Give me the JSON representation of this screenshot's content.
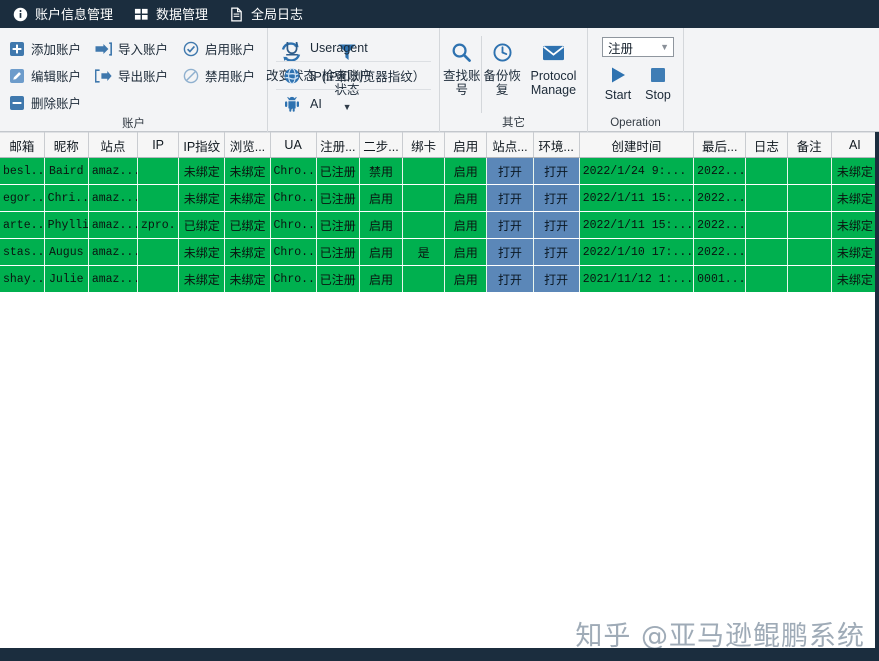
{
  "menubar": {
    "items": [
      {
        "label": "账户信息管理",
        "icon": "info-circle-icon"
      },
      {
        "label": "数据管理",
        "icon": "grid-squares-icon"
      },
      {
        "label": "全局日志",
        "icon": "document-icon"
      }
    ]
  },
  "ribbon": {
    "groups": [
      {
        "name": "account",
        "title": "账户",
        "col1": [
          {
            "label": "添加账户",
            "icon": "plus-square-icon"
          },
          {
            "label": "编辑账户",
            "icon": "pencil-square-icon"
          },
          {
            "label": "删除账户",
            "icon": "minus-square-icon"
          }
        ],
        "col2": [
          {
            "label": "导入账户",
            "icon": "import-arrow-icon"
          },
          {
            "label": "导出账户",
            "icon": "export-arrow-icon"
          }
        ],
        "col3": [
          {
            "label": "启用账户",
            "icon": "check-circle-icon"
          },
          {
            "label": "禁用账户",
            "icon": "ban-circle-icon"
          }
        ],
        "big": [
          {
            "label": "改变状态",
            "icon": "refresh-icon",
            "caret": "▼"
          },
          {
            "label": "检查账户状态",
            "icon": "filter-icon",
            "caret": "▼"
          }
        ]
      },
      {
        "name": "fingerprint",
        "title": "",
        "rows": [
          {
            "label": "Useragent",
            "icon": "underline-u-icon"
          },
          {
            "label": "IP(IP和浏览器指纹）",
            "icon": "globe-icon"
          },
          {
            "label": "AI",
            "icon": "android-robot-icon"
          }
        ]
      },
      {
        "name": "other",
        "title": "其它",
        "big": [
          {
            "label": "查找账号",
            "icon": "magnifier-icon"
          },
          {
            "label": "备份恢复",
            "icon": "clock-icon"
          },
          {
            "label": "Protocol Manage",
            "icon": "envelope-icon"
          }
        ]
      },
      {
        "name": "operation",
        "title": "Operation",
        "combo_value": "注册",
        "combo_caret": "▼",
        "buttons": [
          {
            "label": "Start",
            "icon": "play-triangle-icon"
          },
          {
            "label": "Stop",
            "icon": "stop-square-icon"
          }
        ]
      }
    ]
  },
  "grid": {
    "columns": [
      {
        "key": "email",
        "label": "邮箱",
        "width": 44
      },
      {
        "key": "nickname",
        "label": "昵称",
        "width": 44
      },
      {
        "key": "site",
        "label": "站点",
        "width": 49
      },
      {
        "key": "ip",
        "label": "IP",
        "width": 41
      },
      {
        "key": "ip_fp",
        "label": "IP指纹",
        "width": 46
      },
      {
        "key": "browser",
        "label": "浏览...",
        "width": 45
      },
      {
        "key": "ua",
        "label": "UA",
        "width": 46
      },
      {
        "key": "register",
        "label": "注册...",
        "width": 43
      },
      {
        "key": "two_step",
        "label": "二步...",
        "width": 43
      },
      {
        "key": "bind_card",
        "label": "绑卡",
        "width": 42
      },
      {
        "key": "enabled",
        "label": "启用",
        "width": 42
      },
      {
        "key": "site_open",
        "label": "站点...",
        "width": 46
      },
      {
        "key": "env_open",
        "label": "环境...",
        "width": 46
      },
      {
        "key": "create_time",
        "label": "创建时间",
        "width": 114
      },
      {
        "key": "last_time",
        "label": "最后...",
        "width": 52
      },
      {
        "key": "log",
        "label": "日志",
        "width": 41
      },
      {
        "key": "remark",
        "label": "备注",
        "width": 44
      },
      {
        "key": "ai",
        "label": "AI",
        "width": 47
      }
    ],
    "rows": [
      {
        "email": "besl...",
        "nickname": "Baird",
        "site": "amaz...",
        "ip": "",
        "ip_fp": "未绑定",
        "browser": "未绑定",
        "ua": "Chro...",
        "register": "已注册",
        "two_step": "禁用",
        "bind_card": "",
        "enabled": "启用",
        "site_open": "打开",
        "env_open": "打开",
        "create_time": "2022/1/24 9:...",
        "last_time": "2022...",
        "log": "",
        "remark": "",
        "ai": "未绑定"
      },
      {
        "email": "egor...",
        "nickname": "Chri...",
        "site": "amaz...",
        "ip": "",
        "ip_fp": "未绑定",
        "browser": "未绑定",
        "ua": "Chro...",
        "register": "已注册",
        "two_step": "启用",
        "bind_card": "",
        "enabled": "启用",
        "site_open": "打开",
        "env_open": "打开",
        "create_time": "2022/1/11 15:...",
        "last_time": "2022...",
        "log": "",
        "remark": "",
        "ai": "未绑定"
      },
      {
        "email": "arte...",
        "nickname": "Phyllis",
        "site": "amaz...",
        "ip": "zpro...",
        "ip_fp": "已绑定",
        "browser": "已绑定",
        "ua": "Chro...",
        "register": "已注册",
        "two_step": "启用",
        "bind_card": "",
        "enabled": "启用",
        "site_open": "打开",
        "env_open": "打开",
        "create_time": "2022/1/11 15:...",
        "last_time": "2022...",
        "log": "",
        "remark": "",
        "ai": "未绑定"
      },
      {
        "email": "stas...",
        "nickname": "Augus",
        "site": "amaz...",
        "ip": "",
        "ip_fp": "未绑定",
        "browser": "未绑定",
        "ua": "Chro...",
        "register": "已注册",
        "two_step": "启用",
        "bind_card": "是",
        "enabled": "启用",
        "site_open": "打开",
        "env_open": "打开",
        "create_time": "2022/1/10 17:...",
        "last_time": "2022...",
        "log": "",
        "remark": "",
        "ai": "未绑定"
      },
      {
        "email": "shay...",
        "nickname": "Julie",
        "site": "amaz...",
        "ip": "",
        "ip_fp": "未绑定",
        "browser": "未绑定",
        "ua": "Chro...",
        "register": "已注册",
        "two_step": "启用",
        "bind_card": "",
        "enabled": "启用",
        "site_open": "打开",
        "env_open": "打开",
        "create_time": "2021/11/12 1:...",
        "last_time": "0001...",
        "log": "",
        "remark": "",
        "ai": "未绑定"
      }
    ],
    "blue_columns": [
      "site_open",
      "env_open"
    ],
    "cjk_columns": [
      "ip_fp",
      "browser",
      "register",
      "two_step",
      "bind_card",
      "enabled",
      "ai"
    ]
  },
  "watermark": {
    "text": "知乎 @亚马逊鲲鹏系统"
  },
  "colors": {
    "titlebar": "#1b2d3e",
    "ribbon_bg": "#f3f4f6",
    "cell_green": "#00b04f",
    "cell_blue": "#5b87b8",
    "accent_blue": "#2e72b0"
  }
}
